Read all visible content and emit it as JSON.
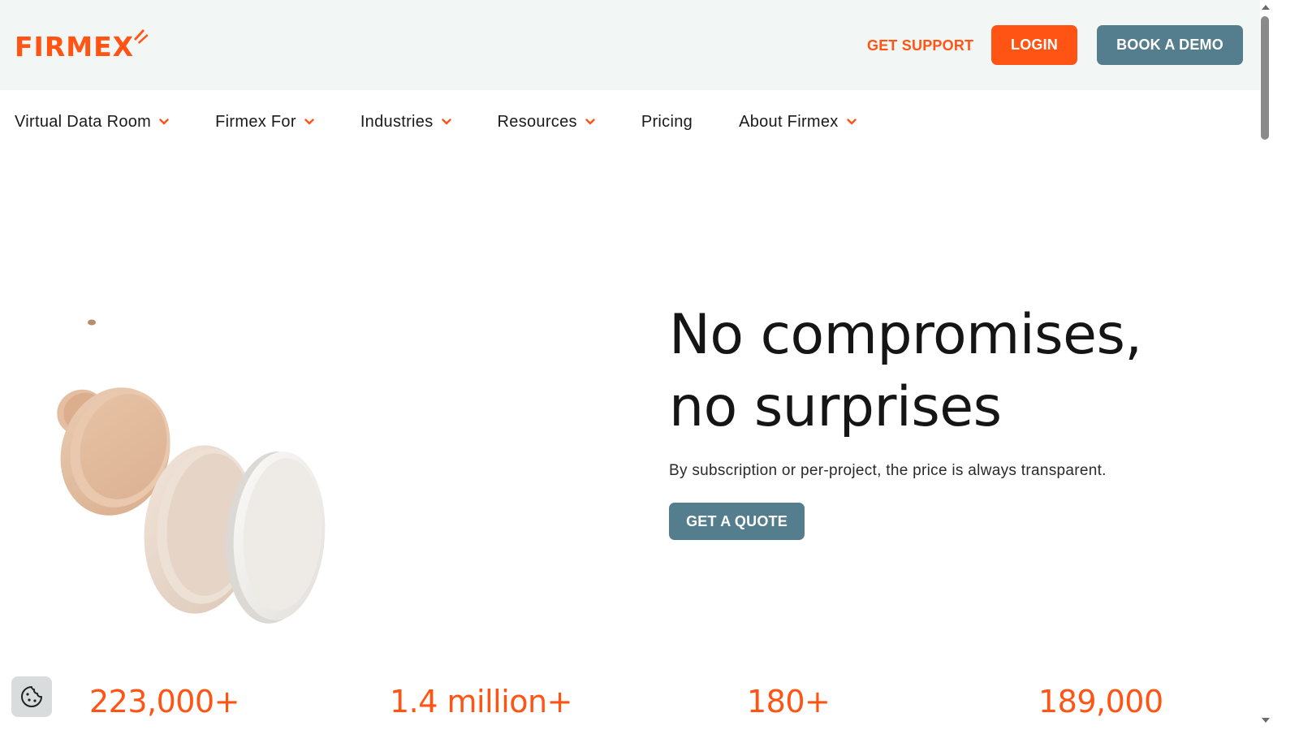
{
  "brand": {
    "name": "FIRMEX",
    "accent": "#ff5414",
    "secondary": "#547e8d"
  },
  "header": {
    "support_label": "GET SUPPORT",
    "login_label": "LOGIN",
    "demo_label": "BOOK A DEMO"
  },
  "nav": {
    "items": [
      {
        "label": "Virtual Data Room",
        "dropdown": true
      },
      {
        "label": "Firmex For",
        "dropdown": true
      },
      {
        "label": "Industries",
        "dropdown": true
      },
      {
        "label": "Resources",
        "dropdown": true
      },
      {
        "label": "Pricing",
        "dropdown": false
      },
      {
        "label": "About Firmex",
        "dropdown": true
      }
    ]
  },
  "hero": {
    "headline_line1": "No compromises,",
    "headline_line2": "no surprises",
    "subtext": "By subscription or per-project, the price is always transparent.",
    "cta_label": "GET A QUOTE"
  },
  "stats": {
    "items": [
      {
        "value": "223,000+"
      },
      {
        "value": "1.4 million+"
      },
      {
        "value": "180+"
      },
      {
        "value": "189,000"
      }
    ]
  },
  "icons": {
    "chevron": "chevron-down-icon",
    "cookie": "cookie-icon"
  }
}
